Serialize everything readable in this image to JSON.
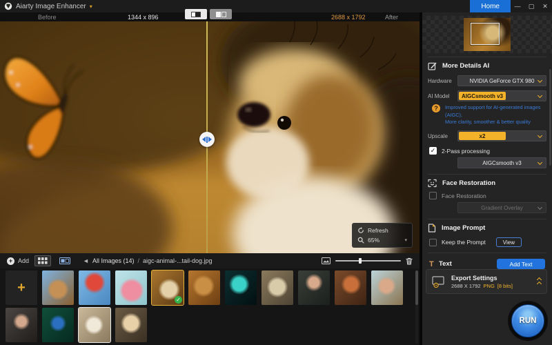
{
  "titlebar": {
    "app_title": "Aiarty Image Enhancer",
    "home_label": "Home"
  },
  "viewer": {
    "before_label": "Before",
    "before_size": "1344 x 896",
    "after_size": "2688 x 1792",
    "after_label": "After",
    "refresh_label": "Refresh",
    "zoom_level": "65%"
  },
  "panel": {
    "more_details_header": "More Details AI",
    "hardware_label": "Hardware",
    "hardware_value": "NVIDIA GeForce GTX 980",
    "ai_model_label": "AI Model",
    "ai_model_value": "AIGCsmooth v3",
    "ai_model_hint_line1": "Improved support for AI-generated images (AIGC),",
    "ai_model_hint_line2": "More clarity, smoother & better quality",
    "upscale_label": "Upscale",
    "upscale_value": "x2",
    "two_pass_label": "2-Pass processing",
    "two_pass_value": "AIGCsmooth v3",
    "face_header": "Face Restoration",
    "face_checkbox_label": "Face Restoration",
    "face_dropdown_value": "Gradient Overlay",
    "prompt_header": "Image Prompt",
    "keep_prompt_label": "Keep the Prompt",
    "view_button": "View",
    "text_header": "Text",
    "add_text_button": "Add Text",
    "export_title": "Export Settings",
    "export_size": "2688 X 1792",
    "export_format": "PNG",
    "export_bits": "[8 bits]",
    "run_label": "RUN"
  },
  "gallery": {
    "add_label": "Add",
    "breadcrumb": {
      "back_icon": "◄",
      "all": "All Images (14)",
      "sep": "/",
      "file": "aigc-animal-...tail-dog.jpg"
    },
    "rows": [
      [
        {
          "type": "add",
          "name": "add-image-tile"
        },
        {
          "name": "thumb-lion-cub",
          "c": [
            "#7fb3e0",
            "#8a5f2e"
          ],
          "dot": {
            "x": 50,
            "y": 55,
            "r": 30,
            "c": "#c49055"
          }
        },
        {
          "name": "thumb-hot-air-balloon",
          "c": [
            "#7fb9e6",
            "#4a88c0"
          ],
          "dot": {
            "x": 50,
            "y": 35,
            "r": 26,
            "c": "#e0483a"
          }
        },
        {
          "name": "thumb-flamingo",
          "c": [
            "#bfe3e8",
            "#8fc5cc"
          ],
          "dot": {
            "x": 52,
            "y": 58,
            "r": 34,
            "c": "#ef8ea0"
          }
        },
        {
          "name": "thumb-puppy",
          "c": [
            "#a9762f",
            "#5e3a14"
          ],
          "dot": {
            "x": 55,
            "y": 55,
            "r": 28,
            "c": "#e3d0a8"
          },
          "selected": true
        },
        {
          "name": "thumb-lion",
          "c": [
            "#b5762f",
            "#6e3f12"
          ],
          "dot": {
            "x": 48,
            "y": 45,
            "r": 30,
            "c": "#c98f45"
          }
        },
        {
          "name": "thumb-fantasy-landscape",
          "c": [
            "#0c2e30",
            "#031012"
          ],
          "dot": {
            "x": 45,
            "y": 40,
            "r": 24,
            "c": "#3ad2c8"
          }
        },
        {
          "name": "thumb-moth",
          "c": [
            "#8a7a5c",
            "#4e4434"
          ],
          "dot": {
            "x": 50,
            "y": 48,
            "r": 30,
            "c": "#d8cbaa"
          }
        },
        {
          "name": "thumb-man-portrait",
          "c": [
            "#3a3f3a",
            "#1c201c"
          ],
          "dot": {
            "x": 50,
            "y": 35,
            "r": 18,
            "c": "#d8a98a"
          }
        },
        {
          "name": "thumb-redhead-woman",
          "c": [
            "#7a4a2a",
            "#3e2414"
          ],
          "dot": {
            "x": 52,
            "y": 40,
            "r": 24,
            "c": "#c9703a"
          }
        },
        {
          "name": "thumb-beach-woman",
          "c": [
            "#bcd3d8",
            "#8a7450"
          ],
          "dot": {
            "x": 48,
            "y": 45,
            "r": 24,
            "c": "#d9a98a"
          }
        }
      ],
      [
        {
          "name": "thumb-woman-portrait",
          "c": [
            "#4a4542",
            "#201d1b"
          ],
          "dot": {
            "x": 50,
            "y": 40,
            "r": 18,
            "c": "#d4a88c"
          }
        },
        {
          "name": "thumb-peacock-macro",
          "c": [
            "#0f4f3a",
            "#062a20"
          ],
          "dot": {
            "x": 50,
            "y": 45,
            "r": 20,
            "c": "#2a6fc0"
          }
        },
        {
          "name": "thumb-wedding-photo",
          "c": [
            "#cbb89a",
            "#8a7a5e"
          ],
          "dot": {
            "x": 48,
            "y": 50,
            "r": 26,
            "c": "#f0e8d8"
          },
          "framed": true
        },
        {
          "name": "thumb-group-photo",
          "c": [
            "#6a5a42",
            "#3a3024"
          ],
          "dot": {
            "x": 50,
            "y": 45,
            "r": 28,
            "c": "#e8d0a8"
          }
        }
      ]
    ]
  },
  "icons": {
    "plus": "+",
    "check": "✓",
    "help": "?",
    "text_tool": "T",
    "title_chevron": "▾",
    "zoom_chevron": "▾",
    "minimize": "—",
    "maximize": "▢",
    "close": "✕"
  },
  "colors": {
    "accent_yellow": "#f2b32a",
    "accent_blue": "#2273dd",
    "hint_blue": "#3a7bd5",
    "selected_green": "#35b24a"
  }
}
